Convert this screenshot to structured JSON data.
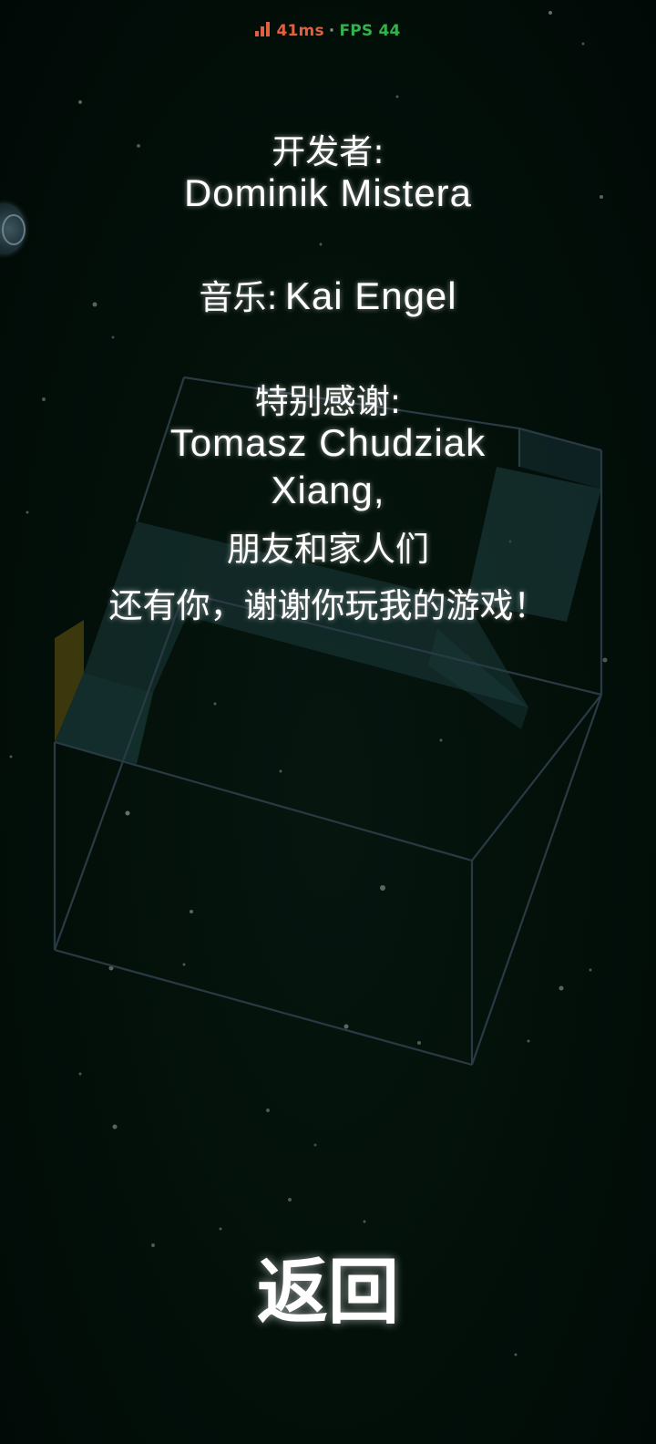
{
  "status_bar": {
    "signal_icon": "signal-bars-icon",
    "latency": "41ms",
    "separator": "·",
    "fps": "FPS 44",
    "colors": {
      "latency": "#e0613f",
      "fps": "#35b04c"
    }
  },
  "credits": {
    "developer_heading": "开发者:",
    "developer_name": "Dominik Mistera",
    "music_label": "音乐:",
    "music_name": "Kai Engel",
    "thanks_heading": "特别感谢:",
    "thanks_names": [
      "Tomasz Chudziak",
      "Xiang,"
    ],
    "thanks_friends": "朋友和家人们",
    "thanks_player": "还有你，谢谢你玩我的游戏！"
  },
  "back_button": {
    "label": "返回"
  },
  "colors": {
    "background": "#020e08",
    "text": "#ffffff",
    "cube_edge": "#2a3a44",
    "cube_face": "#1c3a3c"
  }
}
